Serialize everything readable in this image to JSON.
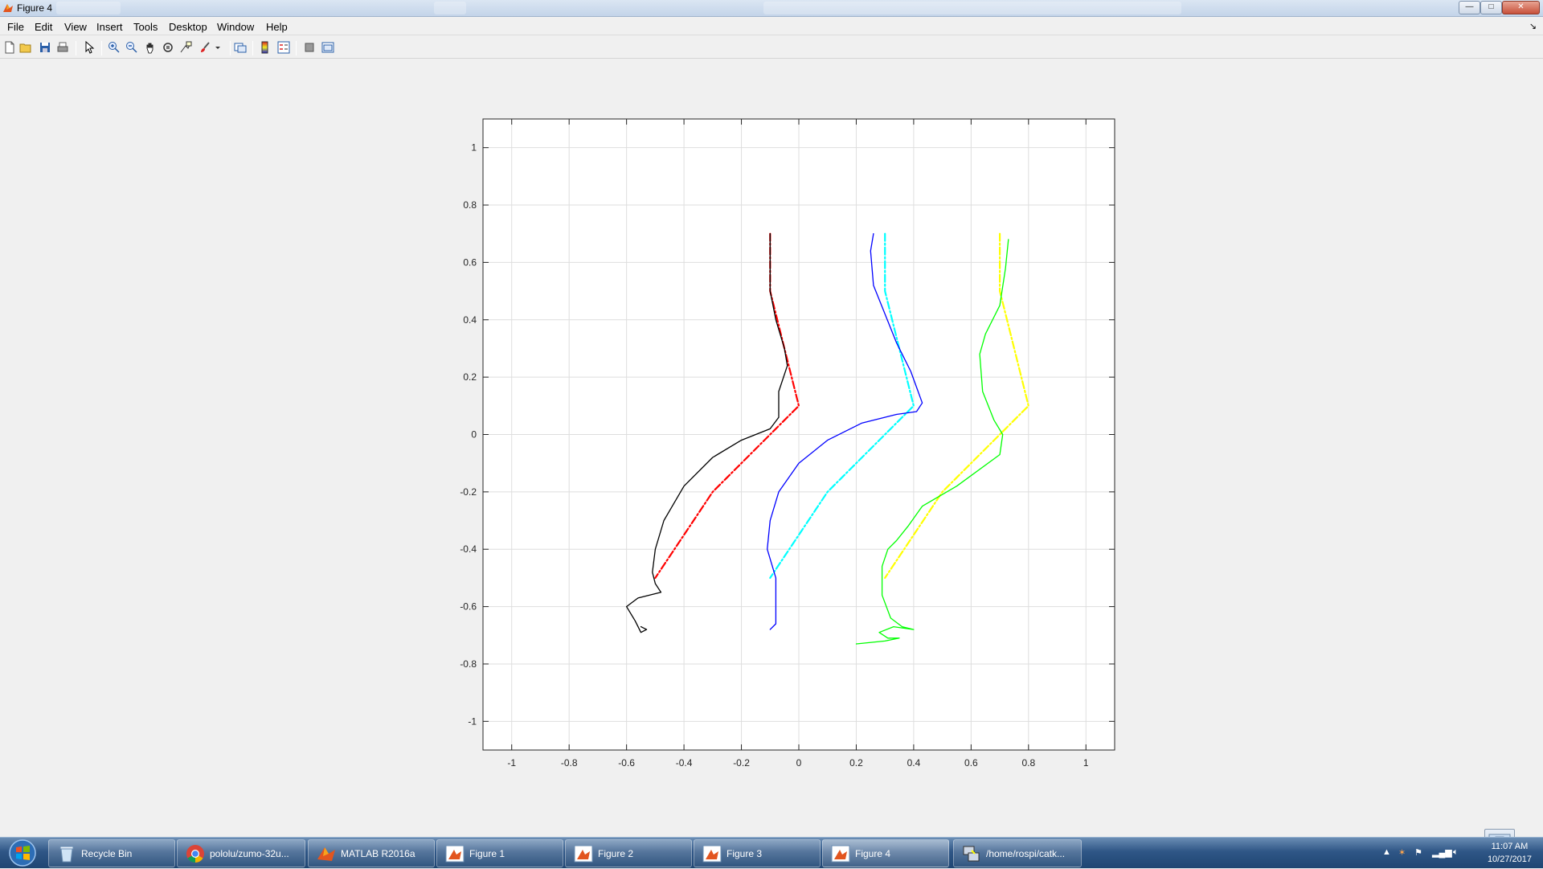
{
  "window": {
    "title": "Figure 4",
    "min_label": "—",
    "max_label": "□",
    "close_label": "✕"
  },
  "menu": [
    "File",
    "Edit",
    "View",
    "Insert",
    "Tools",
    "Desktop",
    "Window",
    "Help"
  ],
  "menu_dock_label": "↘",
  "toolbar": [
    "new-figure-icon",
    "open-file-icon",
    "save-icon",
    "print-icon",
    "pointer-icon",
    "zoom-in-icon",
    "zoom-out-icon",
    "pan-icon",
    "rotate-3d-icon",
    "data-cursor-icon",
    "brush-icon",
    "brush-dropdown-icon",
    "link-plot-icon",
    "colorbar-icon",
    "legend-icon",
    "hide-plot-tools-icon",
    "show-plot-tools-icon"
  ],
  "chart_data": {
    "type": "line",
    "title": "",
    "xlabel": "",
    "ylabel": "",
    "xlim": [
      -1.1,
      1.1
    ],
    "ylim": [
      -1.1,
      1.1
    ],
    "xticks": [
      -1,
      -0.8,
      -0.6,
      -0.4,
      -0.2,
      0,
      0.2,
      0.4,
      0.6,
      0.8,
      1
    ],
    "yticks": [
      -1,
      -0.8,
      -0.6,
      -0.4,
      -0.2,
      0,
      0.2,
      0.4,
      0.6,
      0.8,
      1
    ],
    "xtick_labels": [
      "-1",
      "-0.8",
      "-0.6",
      "-0.4",
      "-0.2",
      "0",
      "0.2",
      "0.4",
      "0.6",
      "0.8",
      "1"
    ],
    "ytick_labels": [
      "-1",
      "-0.8",
      "-0.6",
      "-0.4",
      "-0.2",
      "0",
      "0.2",
      "0.4",
      "0.6",
      "0.8",
      "1"
    ],
    "grid": true,
    "series": [
      {
        "color": "#ff0000",
        "style": "dashdot",
        "width": 2.2,
        "x": [
          -0.1,
          -0.1,
          -0.05,
          0.0,
          -0.3,
          -0.5
        ],
        "y": [
          0.7,
          0.5,
          0.3,
          0.1,
          -0.2,
          -0.5
        ]
      },
      {
        "color": "#000000",
        "style": "solid",
        "width": 1.3,
        "x": [
          -0.1,
          -0.1,
          -0.08,
          -0.05,
          -0.04,
          -0.07,
          -0.07,
          -0.1,
          -0.2,
          -0.3,
          -0.4,
          -0.47,
          -0.5,
          -0.51,
          -0.5,
          -0.48,
          -0.56,
          -0.6,
          -0.57,
          -0.55,
          -0.53,
          -0.55
        ],
        "y": [
          0.7,
          0.5,
          0.4,
          0.3,
          0.24,
          0.15,
          0.06,
          0.02,
          -0.02,
          -0.08,
          -0.18,
          -0.3,
          -0.4,
          -0.48,
          -0.52,
          -0.55,
          -0.57,
          -0.6,
          -0.65,
          -0.69,
          -0.68,
          -0.67
        ]
      },
      {
        "color": "#00ffff",
        "style": "dashdot",
        "width": 2.2,
        "x": [
          0.3,
          0.3,
          0.35,
          0.4,
          0.1,
          -0.1
        ],
        "y": [
          0.7,
          0.5,
          0.3,
          0.1,
          -0.2,
          -0.5
        ]
      },
      {
        "color": "#0000ff",
        "style": "solid",
        "width": 1.3,
        "x": [
          0.26,
          0.25,
          0.26,
          0.3,
          0.34,
          0.39,
          0.43,
          0.41,
          0.34,
          0.22,
          0.1,
          0.0,
          -0.07,
          -0.1,
          -0.11,
          -0.08,
          -0.08,
          -0.1
        ],
        "y": [
          0.7,
          0.64,
          0.52,
          0.42,
          0.32,
          0.22,
          0.11,
          0.08,
          0.07,
          0.04,
          -0.02,
          -0.1,
          -0.2,
          -0.3,
          -0.4,
          -0.5,
          -0.66,
          -0.68
        ]
      },
      {
        "color": "#ffff00",
        "style": "dashdot",
        "width": 2.2,
        "x": [
          0.7,
          0.7,
          0.75,
          0.8,
          0.5,
          0.3
        ],
        "y": [
          0.7,
          0.5,
          0.3,
          0.1,
          -0.2,
          -0.5
        ]
      },
      {
        "color": "#00ff00",
        "style": "solid",
        "width": 1.3,
        "x": [
          0.73,
          0.72,
          0.7,
          0.65,
          0.63,
          0.64,
          0.68,
          0.71,
          0.7,
          0.55,
          0.43,
          0.38,
          0.34,
          0.31,
          0.29,
          0.29,
          0.32,
          0.36,
          0.4,
          0.33,
          0.28,
          0.31,
          0.35,
          0.3,
          0.2
        ],
        "y": [
          0.68,
          0.58,
          0.45,
          0.35,
          0.28,
          0.15,
          0.05,
          0.0,
          -0.07,
          -0.18,
          -0.25,
          -0.32,
          -0.37,
          -0.4,
          -0.46,
          -0.56,
          -0.64,
          -0.67,
          -0.68,
          -0.67,
          -0.69,
          -0.71,
          -0.71,
          -0.72,
          -0.73
        ]
      }
    ]
  },
  "taskbar": {
    "items": [
      {
        "label": "Recycle Bin",
        "icon": "recycle-bin-icon"
      },
      {
        "label": "pololu/zumo-32u...",
        "icon": "chrome-icon"
      },
      {
        "label": "MATLAB R2016a",
        "icon": "matlab-icon"
      },
      {
        "label": "Figure 1",
        "icon": "matlab-figure-icon"
      },
      {
        "label": "Figure 2",
        "icon": "matlab-figure-icon"
      },
      {
        "label": "Figure 3",
        "icon": "matlab-figure-icon"
      },
      {
        "label": "Figure 4",
        "icon": "matlab-figure-icon"
      },
      {
        "label": "/home/rospi/catk...",
        "icon": "putty-icon"
      }
    ],
    "time": "11:07 AM",
    "date": "10/27/2017"
  }
}
